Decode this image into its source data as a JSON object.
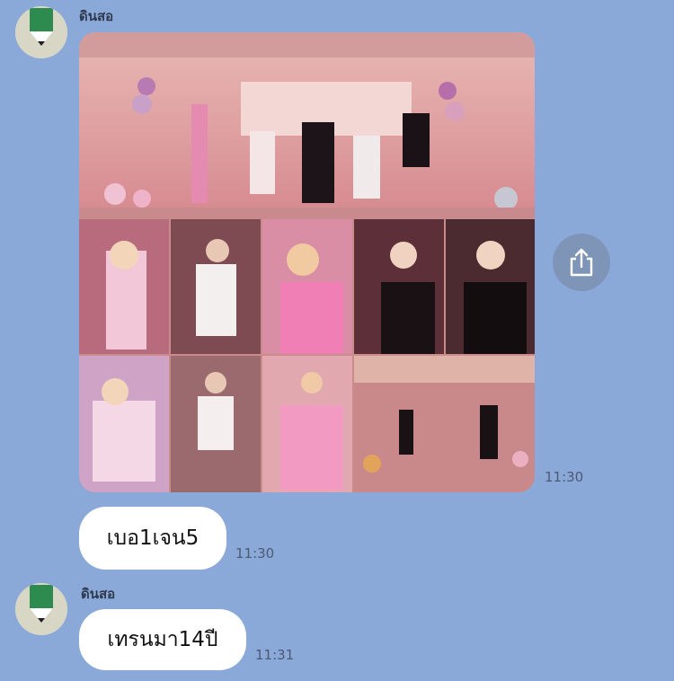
{
  "chat": {
    "sender_name": "ดินสอ",
    "avatar_icon": "pencil-icon",
    "messages": [
      {
        "type": "photo-grid",
        "sender": "ดินสอ",
        "time": "11:30",
        "photos": [
          "group-photo-pink-lounge",
          "portrait-1",
          "portrait-2",
          "portrait-3",
          "portrait-4",
          "portrait-5",
          "portrait-6",
          "portrait-7",
          "portrait-8",
          "group-photo-hall"
        ]
      },
      {
        "type": "text",
        "sender": "self",
        "text": "เบอ1เจน5",
        "time": "11:30"
      },
      {
        "type": "text",
        "sender": "ดินสอ",
        "text": "เทรนมา14ปี",
        "time": "11:31"
      }
    ],
    "share_icon": "share-icon"
  },
  "colors": {
    "background": "#8aa8d8",
    "bubble": "#ffffff",
    "avatar_bg": "#d8d7c6",
    "pencil_green": "#2e8b4f"
  }
}
